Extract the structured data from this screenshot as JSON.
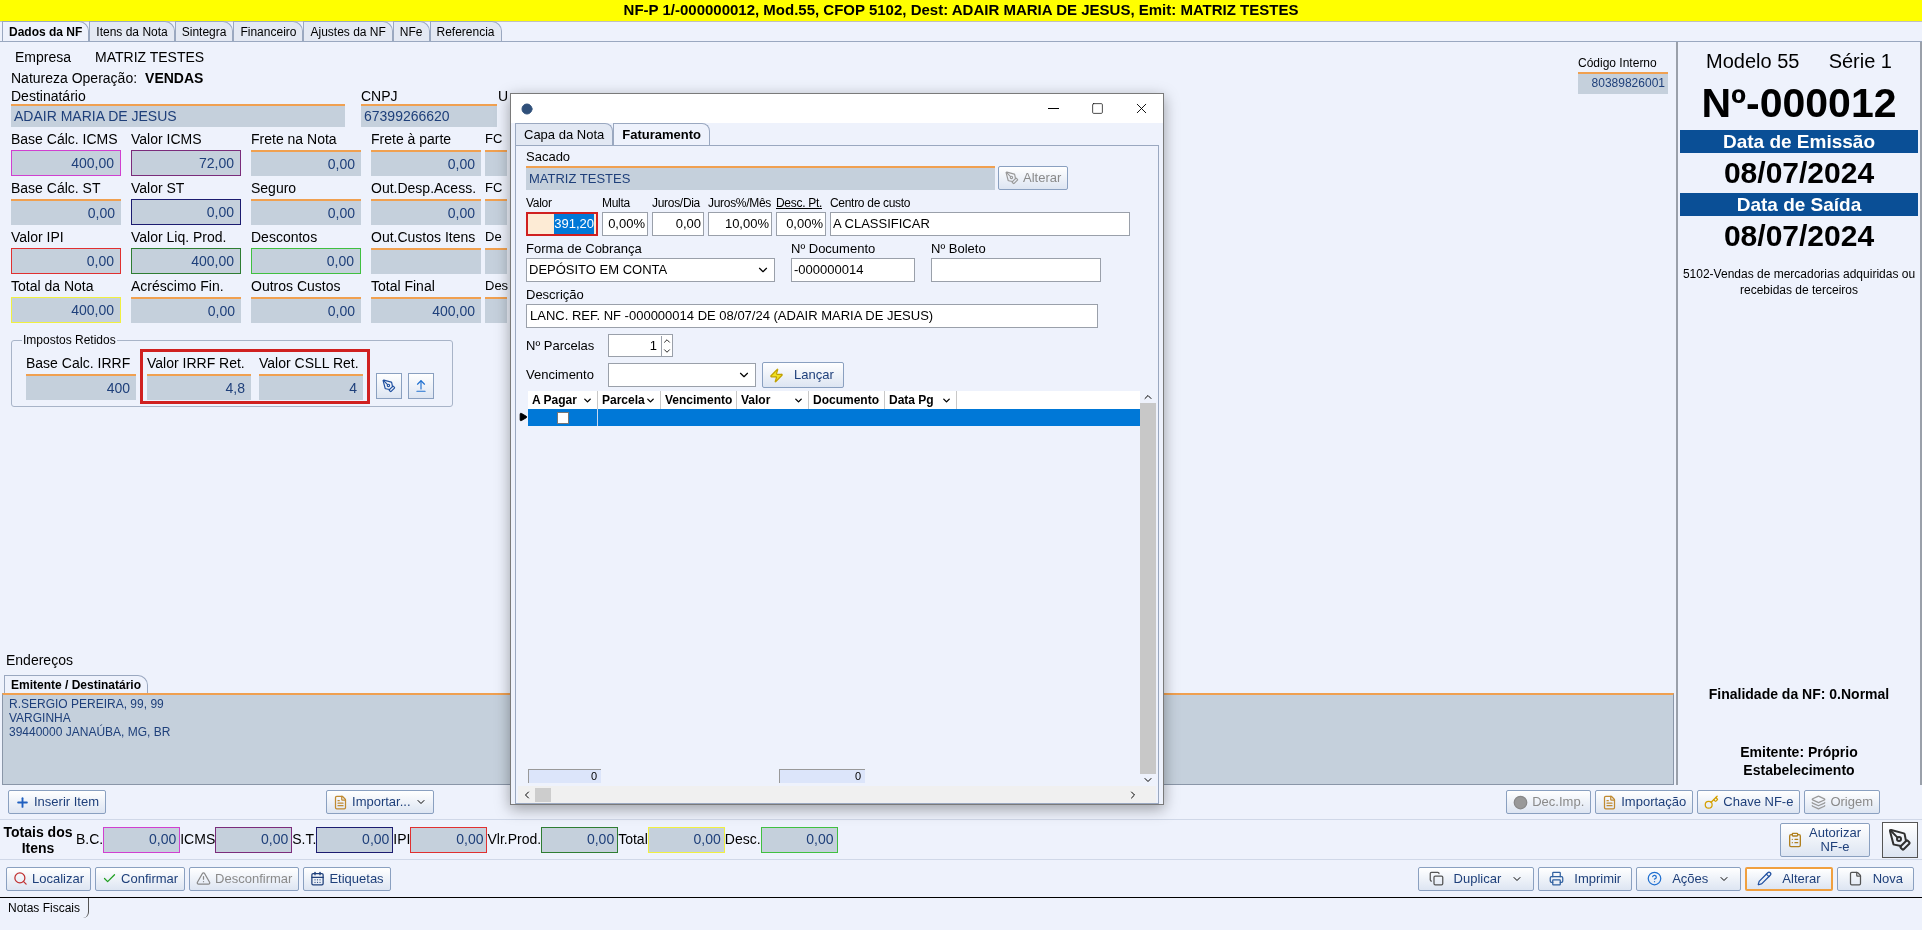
{
  "title_bar": "NF-P 1/-000000012, Mod.55, CFOP 5102, Dest: ADAIR MARIA DE JESUS, Emit: MATRIZ TESTES",
  "tabs": [
    {
      "label": "Dados da NF",
      "selected": true
    },
    {
      "label": "Itens da Nota",
      "selected": false
    },
    {
      "label": "Sintegra",
      "selected": false
    },
    {
      "label": "Financeiro",
      "selected": false
    },
    {
      "label": "Ajustes da NF",
      "selected": false
    },
    {
      "label": "NFe",
      "selected": false
    },
    {
      "label": "Referencia",
      "selected": false
    }
  ],
  "form": {
    "empresa": {
      "label": "Empresa",
      "value": "MATRIZ TESTES"
    },
    "natureza": {
      "label": "Natureza Operação:",
      "value": "VENDAS"
    },
    "destinatario": {
      "label": "Destinatário",
      "value": "ADAIR MARIA DE JESUS"
    },
    "cnpj": {
      "label": "CNPJ",
      "value": "67399266620"
    },
    "column_3_label": "U",
    "codigo_interno": {
      "label": "Código Interno",
      "value": "80389826001"
    },
    "value_rows": [
      [
        {
          "label": "Base Cálc. ICMS",
          "value": "400,00",
          "color": "#d040d0"
        },
        {
          "label": "Valor ICMS",
          "value": "72,00",
          "color": "#7b2c7b"
        },
        {
          "label": "Frete na Nota",
          "value": "0,00"
        },
        {
          "label": "Frete à parte",
          "value": "0,00"
        },
        {
          "label": "FC"
        }
      ],
      [
        {
          "label": "Base Cálc. ST",
          "value": "0,00"
        },
        {
          "label": "Valor ST",
          "value": "0,00",
          "color": "#1c1c70"
        },
        {
          "label": "Seguro",
          "value": "0,00"
        },
        {
          "label": "Out.Desp.Acess.",
          "value": "0,00"
        },
        {
          "label": "FC"
        }
      ],
      [
        {
          "label": "Valor IPI",
          "value": "0,00",
          "color": "#e03030"
        },
        {
          "label": "Valor Liq. Prod.",
          "value": "400,00",
          "color": "#2e7d32"
        },
        {
          "label": "Descontos",
          "value": "0,00",
          "color": "#40c040"
        },
        {
          "label": "Out.Custos Itens"
        },
        {
          "label": "De"
        }
      ],
      [
        {
          "label": "Total da Nota",
          "value": "400,00",
          "color": "#f0f040"
        },
        {
          "label": "Acréscimo Fin.",
          "value": "0,00"
        },
        {
          "label": "Outros Custos",
          "value": "0,00"
        },
        {
          "label": "Total Final",
          "value": "400,00"
        },
        {
          "label": "Des"
        }
      ]
    ],
    "impostos_retidos": {
      "title": "Impostos Retidos",
      "fields": [
        {
          "label": "Base Calc. IRRF",
          "value": "400",
          "highlighted": false
        },
        {
          "label": "Valor IRRF Ret.",
          "value": "4,8",
          "highlighted": true
        },
        {
          "label": "Valor CSLL Ret.",
          "value": "4",
          "highlighted": true
        }
      ]
    }
  },
  "enderecos": {
    "title": "Endereços",
    "tab": "Emitente / Destinatário",
    "lines": [
      "R.SERGIO PEREIRA, 99, 99",
      "VARGINHA",
      "39440000 JANAÚBA, MG, BR"
    ]
  },
  "item_buttons": [
    {
      "label": "Inserir Item",
      "dropdown": false
    },
    {
      "label": "Importar...",
      "dropdown": true
    }
  ],
  "nfe_buttons": [
    {
      "label": "Dec.Imp.",
      "disabled": true
    },
    {
      "label": "Importação",
      "disabled": false
    },
    {
      "label": "Chave NF-e",
      "disabled": false
    },
    {
      "label": "Origem",
      "disabled": true
    }
  ],
  "totais": {
    "title": "Totais dos Itens",
    "fields": [
      {
        "label": "B.C.",
        "value": "0,00",
        "color": "#d040d0"
      },
      {
        "label": "ICMS",
        "value": "0,00",
        "color": "#7b2c7b"
      },
      {
        "label": "S.T.",
        "value": "0,00",
        "color": "#1c1c70"
      },
      {
        "label": "IPI",
        "value": "0,00",
        "color": "#e03030"
      },
      {
        "label": "Vlr.Prod.",
        "value": "0,00",
        "color": "#2e7d32"
      },
      {
        "label": "Total",
        "value": "0,00",
        "color": "#f0f040"
      },
      {
        "label": "Desc.",
        "value": "0,00",
        "color": "#40c040"
      }
    ]
  },
  "autorizar_button": "Autorizar NF-e",
  "actions_left": [
    {
      "label": "Localizar",
      "disabled": false
    },
    {
      "label": "Confirmar",
      "disabled": false
    },
    {
      "label": "Desconfirmar",
      "disabled": true
    },
    {
      "label": "Etiquetas",
      "disabled": false
    }
  ],
  "actions_right": [
    {
      "label": "Duplicar",
      "dropdown": true,
      "focused": false
    },
    {
      "label": "Imprimir",
      "dropdown": false,
      "focused": false
    },
    {
      "label": "Ações",
      "dropdown": true,
      "focused": false
    },
    {
      "label": "Alterar",
      "dropdown": false,
      "focused": true
    },
    {
      "label": "Nova",
      "dropdown": false,
      "focused": false
    }
  ],
  "bottom_tab": "Notas Fiscais",
  "summary": {
    "modelo": "Modelo 55",
    "serie": "Série 1",
    "numero": "Nº-000012",
    "emissao_label": "Data de Emissão",
    "emissao": "08/07/2024",
    "saida_label": "Data de Saída",
    "saida": "08/07/2024",
    "cfop": "5102-Vendas de mercadorias adquiridas ou recebidas de terceiros",
    "finalidade": "Finalidade da NF: 0.Normal",
    "emitente": "Emitente: Próprio Estabelecimento"
  },
  "dialog": {
    "tabs": [
      {
        "label": "Capa da Nota",
        "selected": false
      },
      {
        "label": "Faturamento",
        "selected": true
      }
    ],
    "sacado": {
      "label": "Sacado",
      "value": "MATRIZ TESTES"
    },
    "alterar_button": {
      "label": "Alterar",
      "disabled": true
    },
    "values": [
      {
        "label": "Valor",
        "value": "391,20",
        "highlighted": true,
        "text_selected": true,
        "underlined": false
      },
      {
        "label": "Multa",
        "value": "0,00%",
        "highlighted": false,
        "text_selected": false,
        "underlined": false
      },
      {
        "label": "Juros/Dia",
        "value": "0,00",
        "highlighted": false,
        "text_selected": false,
        "underlined": false
      },
      {
        "label": "Juros%/Mês",
        "value": "10,00%",
        "highlighted": false,
        "text_selected": false,
        "underlined": false
      },
      {
        "label": "Desc. Pt.",
        "value": "0,00%",
        "highlighted": false,
        "text_selected": false,
        "underlined": true
      },
      {
        "label": "Centro de custo",
        "value": "A CLASSIFICAR",
        "highlighted": false,
        "text_selected": false,
        "underlined": false
      }
    ],
    "forma_cobranca": {
      "label": "Forma de Cobrança",
      "value": "DEPÓSITO EM CONTA"
    },
    "documento": {
      "label": "Nº Documento",
      "value": "-000000014"
    },
    "boleto": {
      "label": "Nº Boleto"
    },
    "descricao": {
      "label": "Descrição",
      "value": "LANC. REF. NF -000000014 DE 08/07/24 (ADAIR MARIA DE JESUS)"
    },
    "parcelas": {
      "label": "Nº Parcelas",
      "value": "1"
    },
    "vencimento": {
      "label": "Vencimento"
    },
    "lancar_button": "Lançar",
    "grid": {
      "columns": [
        "A Pagar",
        "Parcela",
        "Vencimento",
        "Valor",
        "Documento",
        "Data Pg"
      ],
      "rows": [
        {
          "selected": true,
          "checked": false
        }
      ],
      "footer": [
        "0",
        "0"
      ]
    }
  }
}
